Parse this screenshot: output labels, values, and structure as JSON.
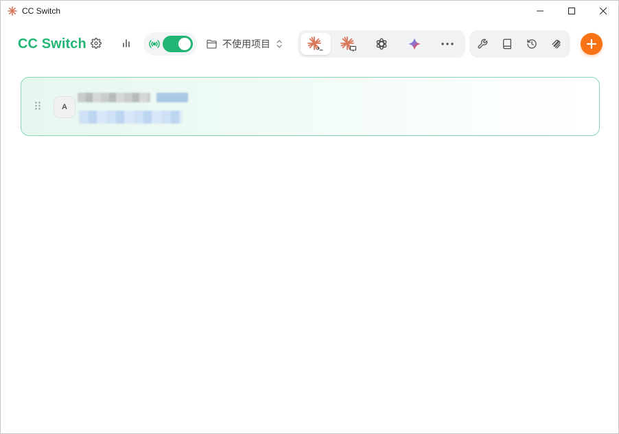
{
  "window": {
    "title": "CC Switch",
    "controls": [
      "minimize",
      "maximize",
      "close"
    ]
  },
  "header": {
    "brand": "CC Switch",
    "settings_icon": "gear-icon",
    "usage_icon": "bar-chart-icon",
    "proxy": {
      "icon": "antenna-icon",
      "enabled": true
    },
    "project_selector": {
      "label": "不使用项目",
      "icon": "folder-icon"
    },
    "app_tabs": [
      {
        "name": "claude-code",
        "icon": "claude-terminal-icon",
        "active": true
      },
      {
        "name": "claude-desktop",
        "icon": "claude-desktop-icon",
        "active": false
      },
      {
        "name": "codex",
        "icon": "openai-icon",
        "active": false
      },
      {
        "name": "gemini",
        "icon": "gemini-icon",
        "active": false
      },
      {
        "name": "more",
        "icon": "more-dots-icon",
        "active": false
      }
    ],
    "tool_tabs": [
      {
        "name": "tools",
        "icon": "wrench-icon"
      },
      {
        "name": "docs",
        "icon": "book-icon"
      },
      {
        "name": "history",
        "icon": "history-icon"
      },
      {
        "name": "mcp",
        "icon": "paperclip-stack-icon"
      }
    ],
    "add_icon": "plus-icon"
  },
  "providers": [
    {
      "avatar": "A",
      "name": "",
      "url": "",
      "active": true
    }
  ],
  "colors": {
    "accent": "#22b573",
    "add_button": "#f97316",
    "card_border": "#86d9b3",
    "claude": "#d97757"
  }
}
